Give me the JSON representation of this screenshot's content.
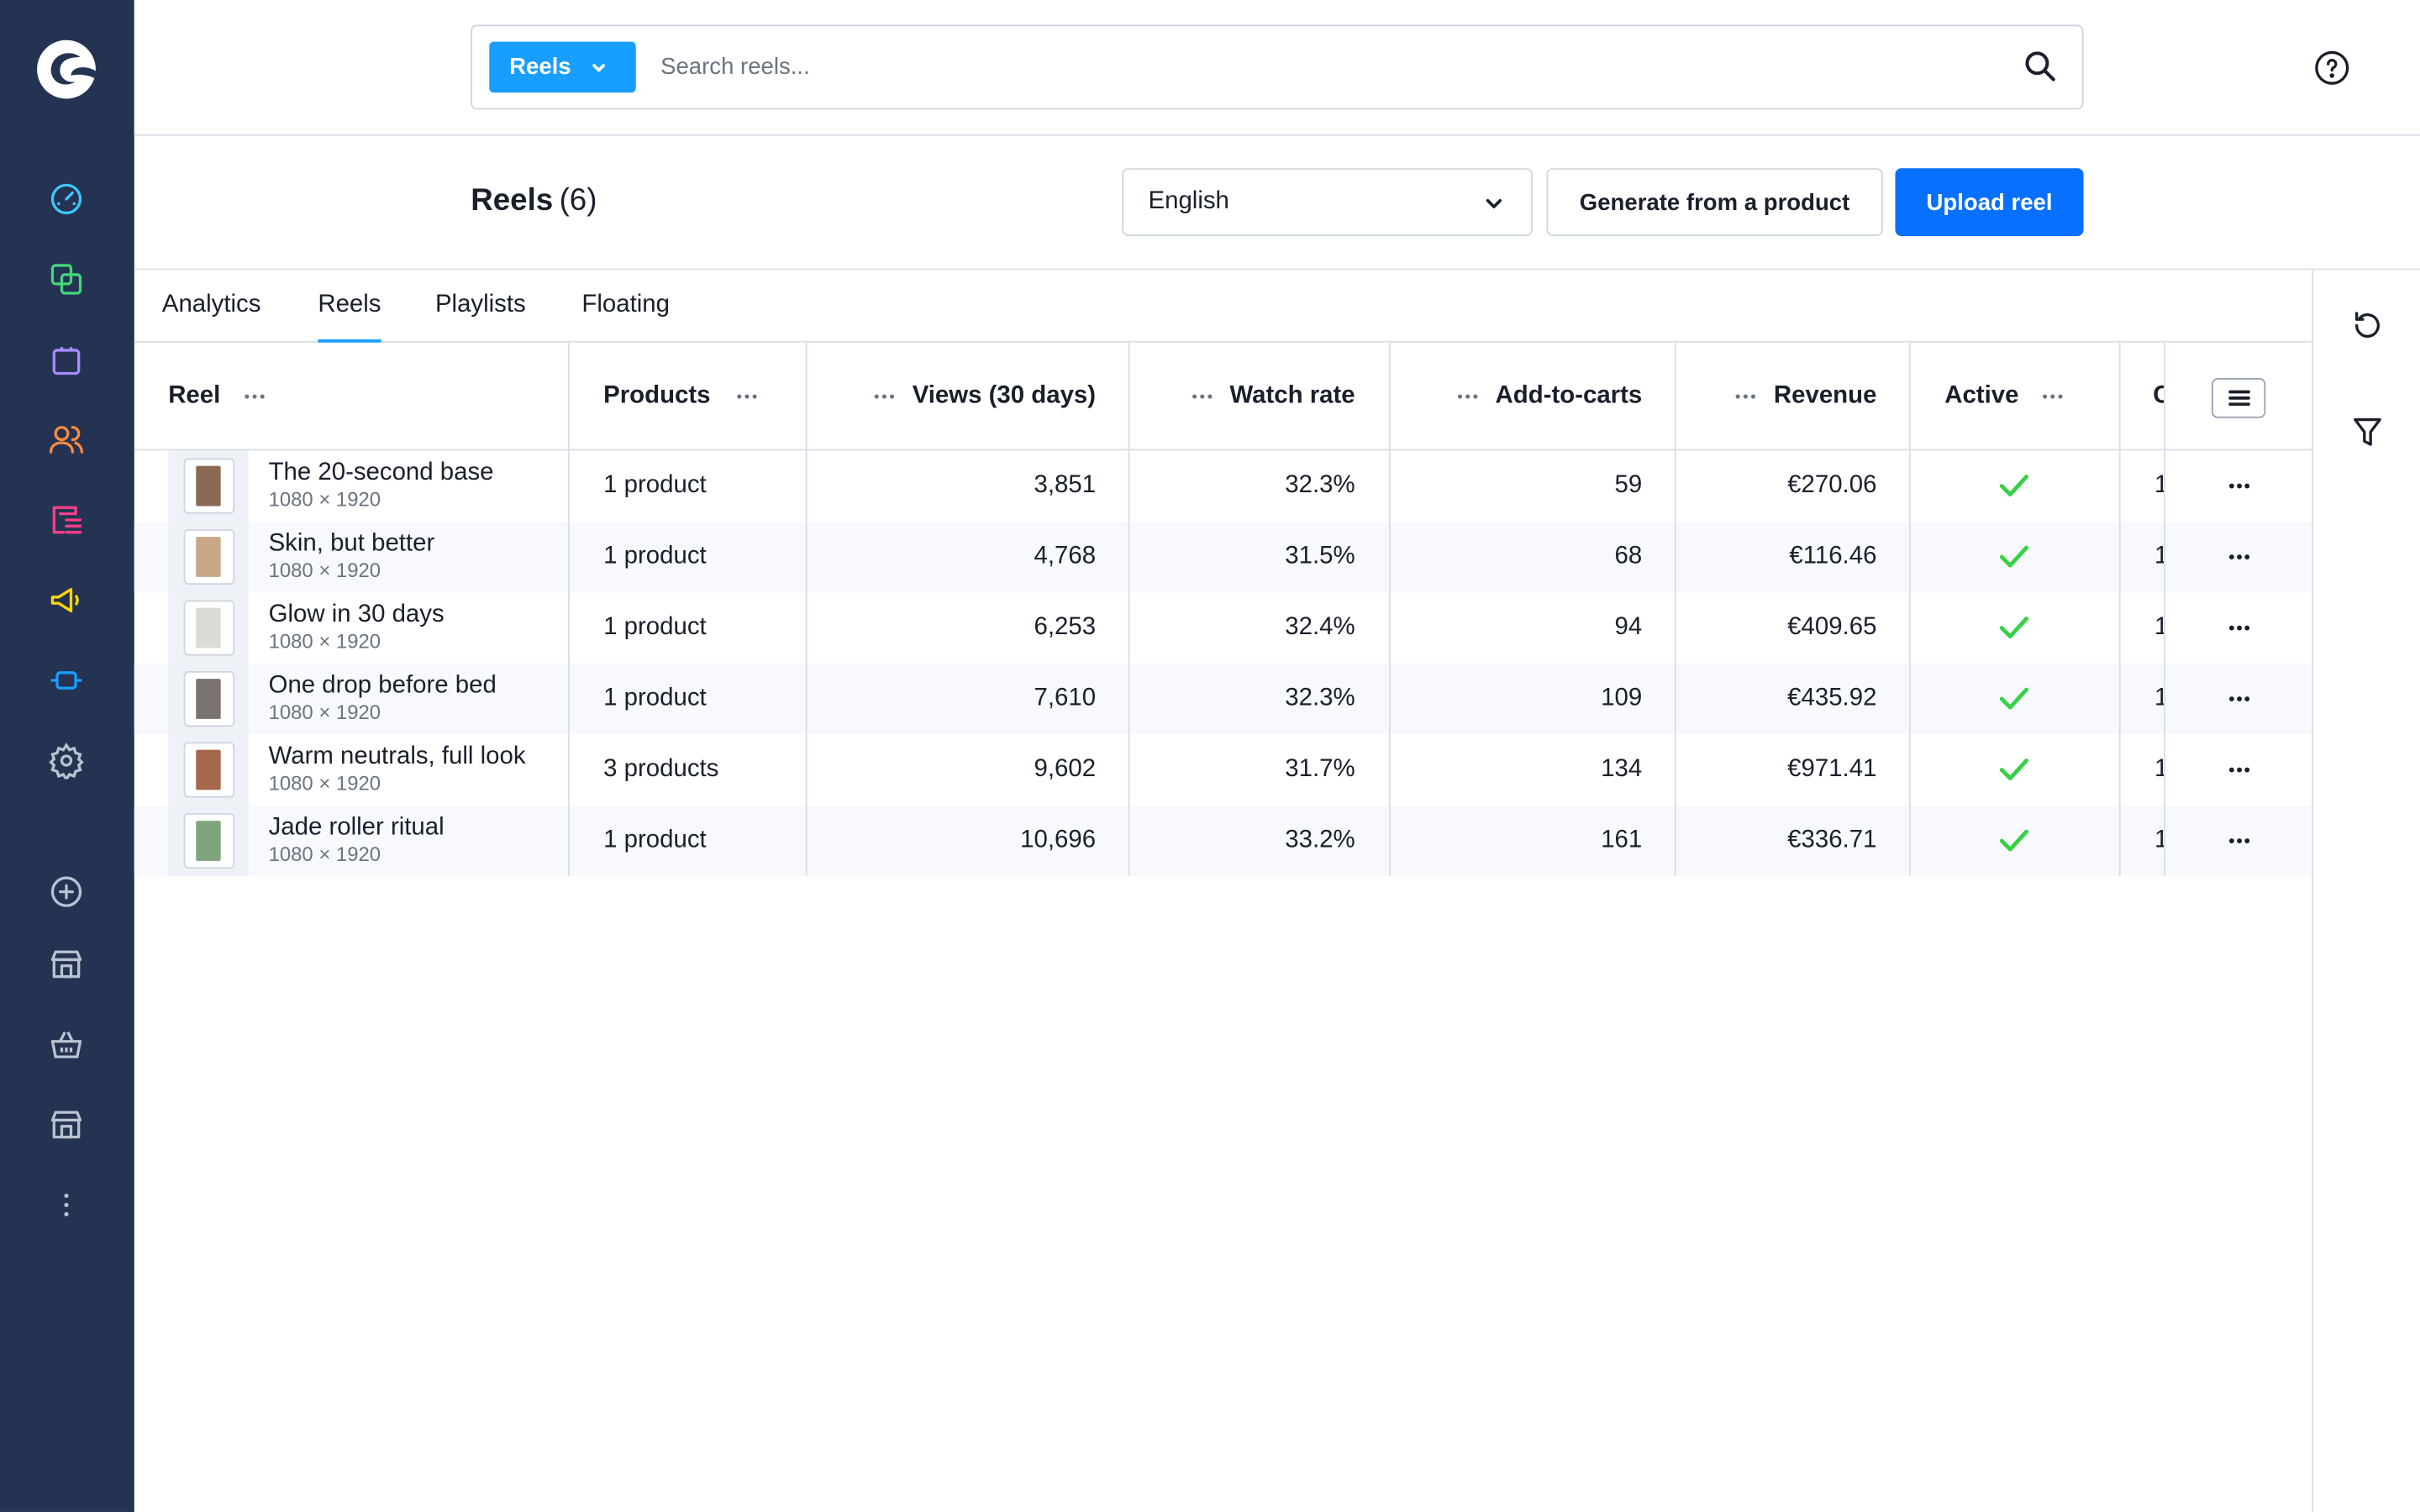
{
  "search": {
    "type_label": "Reels",
    "placeholder": "Search reels..."
  },
  "header": {
    "title": "Reels",
    "count": "(6)",
    "language": "English",
    "generate_label": "Generate from a product",
    "upload_label": "Upload reel"
  },
  "tabs": [
    {
      "label": "Analytics",
      "active": false
    },
    {
      "label": "Reels",
      "active": true
    },
    {
      "label": "Playlists",
      "active": false
    },
    {
      "label": "Floating",
      "active": false
    }
  ],
  "table": {
    "columns": {
      "reel": "Reel",
      "products": "Products",
      "views": "Views (30 days)",
      "watch_rate": "Watch rate",
      "add_to_carts": "Add-to-carts",
      "revenue": "Revenue",
      "active": "Active",
      "clipped": "C"
    },
    "rows": [
      {
        "name": "The 20-second base",
        "dims": "1080 × 1920",
        "products": "1 product",
        "views": "3,851",
        "watch_rate": "32.3%",
        "add_to_carts": "59",
        "revenue": "€270.06",
        "active": true,
        "clipped": "1",
        "thumb_color": "#8a6a55"
      },
      {
        "name": "Skin, but better",
        "dims": "1080 × 1920",
        "products": "1 product",
        "views": "4,768",
        "watch_rate": "31.5%",
        "add_to_carts": "68",
        "revenue": "€116.46",
        "active": true,
        "clipped": "1",
        "thumb_color": "#c9a888"
      },
      {
        "name": "Glow in 30 days",
        "dims": "1080 × 1920",
        "products": "1 product",
        "views": "6,253",
        "watch_rate": "32.4%",
        "add_to_carts": "94",
        "revenue": "€409.65",
        "active": true,
        "clipped": "1",
        "thumb_color": "#dcdad6"
      },
      {
        "name": "One drop before bed",
        "dims": "1080 × 1920",
        "products": "1 product",
        "views": "7,610",
        "watch_rate": "32.3%",
        "add_to_carts": "109",
        "revenue": "€435.92",
        "active": true,
        "clipped": "1",
        "thumb_color": "#7b7370"
      },
      {
        "name": "Warm neutrals, full look",
        "dims": "1080 × 1920",
        "products": "3 products",
        "views": "9,602",
        "watch_rate": "31.7%",
        "add_to_carts": "134",
        "revenue": "€971.41",
        "active": true,
        "clipped": "1",
        "thumb_color": "#a6684a"
      },
      {
        "name": "Jade roller ritual",
        "dims": "1080 × 1920",
        "products": "1 product",
        "views": "10,696",
        "watch_rate": "33.2%",
        "add_to_carts": "161",
        "revenue": "€336.71",
        "active": true,
        "clipped": "1",
        "thumb_color": "#7fa57d"
      }
    ]
  },
  "colors": {
    "sidebar_bg": "#243352",
    "primary": "#0870ff",
    "accent": "#189eff",
    "check": "#37d046"
  },
  "sidebar_icons": [
    "brand-logo",
    "dashboard-icon",
    "catalog-icon",
    "orders-icon",
    "customers-icon",
    "content-icon",
    "marketing-icon",
    "extensions-icon",
    "settings-icon",
    "add-sales-channel-icon",
    "storefront-icon",
    "headless-basket-icon",
    "storefront-icon",
    "more-icon"
  ]
}
